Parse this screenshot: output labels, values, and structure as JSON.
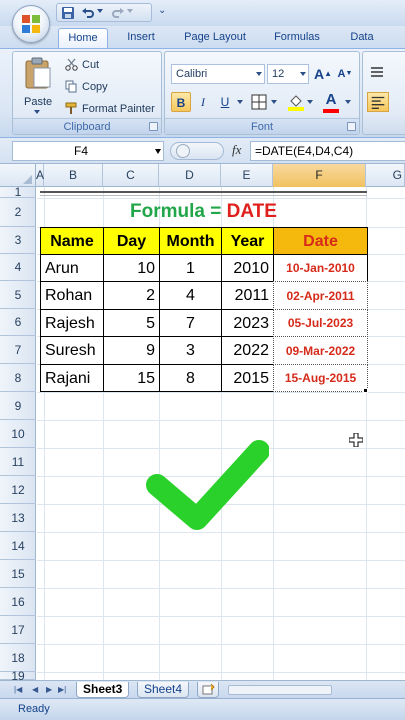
{
  "tabs": [
    "Home",
    "Insert",
    "Page Layout",
    "Formulas",
    "Data"
  ],
  "clipboard": {
    "paste": "Paste",
    "cut": "Cut",
    "copy": "Copy",
    "format_painter": "Format Painter",
    "label": "Clipboard"
  },
  "font": {
    "name": "Calibri",
    "size": "12",
    "label": "Font",
    "bold": "B",
    "italic": "I",
    "underline": "U",
    "grow": "A",
    "shrink": "A",
    "color_letter": "A",
    "fill_color": "#ffff00",
    "font_color": "#ff0000"
  },
  "formula_bar": {
    "name_box": "F4",
    "fx": "fx",
    "formula": "=DATE(E4,D4,C4)"
  },
  "columns": [
    "A",
    "B",
    "C",
    "D",
    "E",
    "F",
    "G"
  ],
  "selected_column": "F",
  "rows": [
    "1",
    "2",
    "3",
    "4",
    "5",
    "6",
    "7",
    "8",
    "9",
    "10",
    "11",
    "12",
    "13",
    "14",
    "15",
    "16",
    "17",
    "18",
    "19"
  ],
  "title": {
    "prefix": "Formula = ",
    "func": "DATE",
    "prefix_color": "#21a64a",
    "func_color": "#e0201c"
  },
  "table": {
    "headers": [
      "Name",
      "Day",
      "Month",
      "Year",
      "Date"
    ],
    "rows": [
      [
        "Arun",
        "10",
        "1",
        "2010",
        "10-Jan-2010"
      ],
      [
        "Rohan",
        "2",
        "4",
        "2011",
        "02-Apr-2011"
      ],
      [
        "Rajesh",
        "5",
        "7",
        "2023",
        "05-Jul-2023"
      ],
      [
        "Suresh",
        "9",
        "3",
        "2022",
        "09-Mar-2022"
      ],
      [
        "Rajani",
        "15",
        "8",
        "2015",
        "15-Aug-2015"
      ]
    ]
  },
  "checkmark": {
    "icon": "checkmark-icon",
    "color": "#2bd12b"
  },
  "sheets": [
    "Sheet3",
    "Sheet4"
  ],
  "active_sheet": "Sheet3",
  "status": "Ready"
}
